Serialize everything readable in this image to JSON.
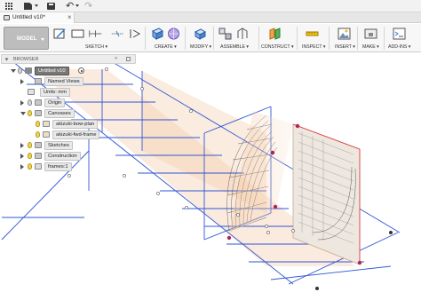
{
  "app": {
    "tab_title": "Untitled v10*",
    "tab_close": "×",
    "undo_glyph": "↶",
    "redo_glyph": "↷",
    "icons": [
      "apps-grid-icon",
      "file-icon",
      "save-icon",
      "undo-icon",
      "redo-icon"
    ]
  },
  "toolbar": {
    "workspace": "MODEL",
    "groups": {
      "sketch": "SKETCH",
      "create": "CREATE",
      "modify": "MODIFY",
      "assemble": "ASSEMBLE",
      "construct": "CONSTRUCT",
      "inspect": "INSPECT",
      "insert": "INSERT",
      "make": "MAKE",
      "addins": "ADD-INS"
    },
    "caret": "▾"
  },
  "browser": {
    "label": "BROWSER",
    "collapse_glyph": "«",
    "root": "Untitled v10",
    "items": {
      "named_views": "Named Views",
      "units": "Units: mm",
      "origin": "Origin",
      "canvases": "Canvases",
      "canvas_1": "akizuki-bow-plan",
      "canvas_2": "akizuki-fwd-frame",
      "sketches": "Sketches",
      "construction": "Construction",
      "frames": "frames:1"
    }
  },
  "colors": {
    "grid_line": "#2f56d6",
    "canvas_plane": "#f5c9a6",
    "hull_curve": "#6b6b6b",
    "point_marker": "#b0235a"
  }
}
